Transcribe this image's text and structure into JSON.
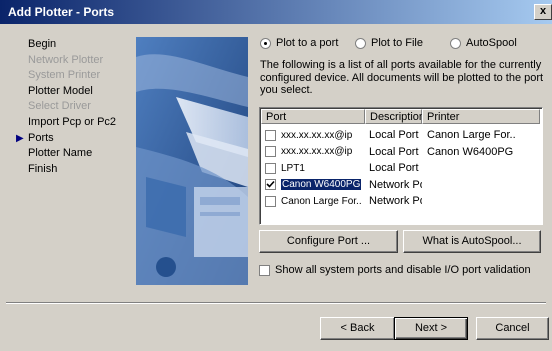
{
  "window": {
    "title": "Add Plotter - Ports",
    "close_glyph": "x"
  },
  "steps": [
    {
      "label": "Begin",
      "state": "normal"
    },
    {
      "label": "Network Plotter",
      "state": "disabled"
    },
    {
      "label": "System Printer",
      "state": "disabled"
    },
    {
      "label": "Plotter Model",
      "state": "normal"
    },
    {
      "label": "Select Driver",
      "state": "disabled"
    },
    {
      "label": "Import Pcp or Pc2",
      "state": "normal"
    },
    {
      "label": "Ports",
      "state": "current"
    },
    {
      "label": "Plotter Name",
      "state": "normal"
    },
    {
      "label": "Finish",
      "state": "normal"
    }
  ],
  "current_marker": "▶",
  "radios": {
    "plot_to_port": {
      "label": "Plot to a port",
      "checked": true
    },
    "plot_to_file": {
      "label": "Plot to File",
      "checked": false
    },
    "autospool": {
      "label": "AutoSpool",
      "checked": false
    }
  },
  "description": "The following is a list of all ports available for the currently configured device. All documents will be plotted to the port you select.",
  "ports_list": {
    "columns": [
      "Port",
      "Description",
      "Printer"
    ],
    "rows": [
      {
        "port": "xxx.xx.xx.xx@ip",
        "description": "Local Port",
        "printer": "Canon Large For..",
        "checked": false,
        "selected": false
      },
      {
        "port": "xxx.xx.xx.xx@ip",
        "description": "Local Port",
        "printer": "Canon W6400PG",
        "checked": false,
        "selected": false
      },
      {
        "port": "LPT1",
        "description": "Local Port",
        "printer": "",
        "checked": false,
        "selected": false
      },
      {
        "port": "Canon W6400PG",
        "description": "Network Port",
        "printer": "",
        "checked": true,
        "selected": true
      },
      {
        "port": "Canon Large For..",
        "description": "Network Port",
        "printer": "",
        "checked": false,
        "selected": false
      }
    ]
  },
  "buttons": {
    "configure_port": "Configure Port ...",
    "what_is_autospool": "What is AutoSpool...",
    "back": "< Back",
    "next": "Next >",
    "cancel": "Cancel"
  },
  "show_all_ports": {
    "label": "Show all system ports and disable I/O port validation",
    "checked": false
  },
  "colors": {
    "title_gradient_start": "#0a246a",
    "title_gradient_end": "#a6caf0",
    "dialog_face": "#d4d0c8",
    "selection": "#0a246a",
    "image_blue": "#2d5b9d"
  }
}
